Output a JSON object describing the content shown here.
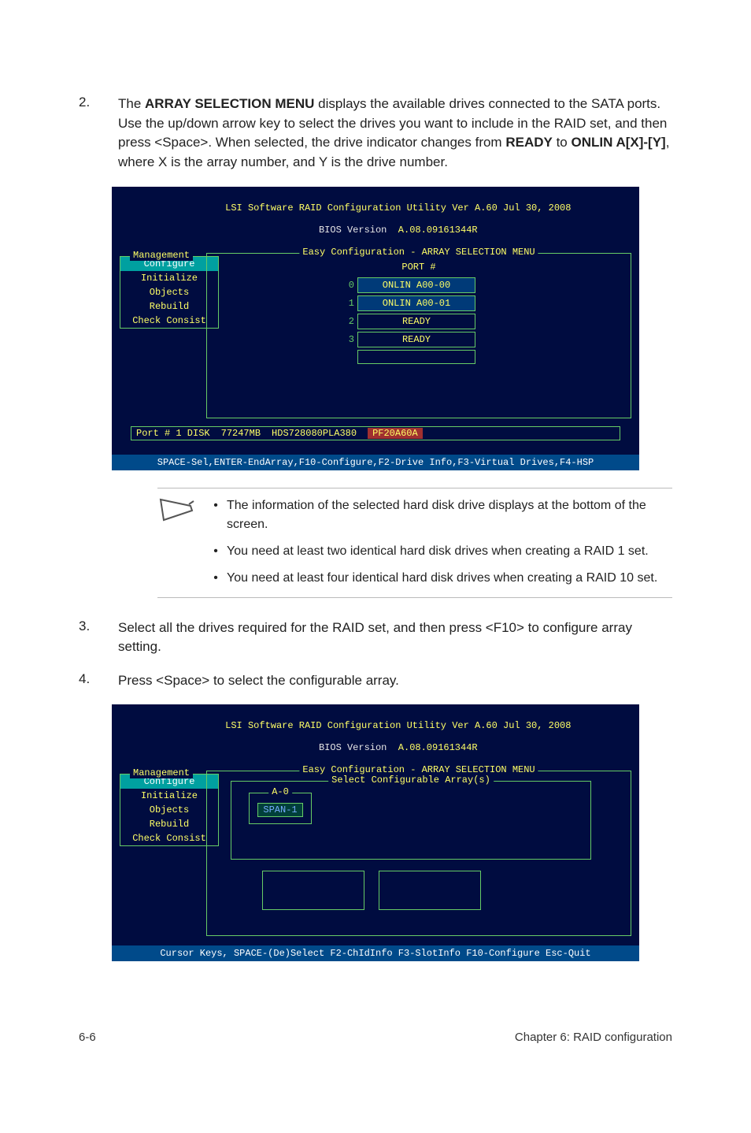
{
  "step2": {
    "num": "2.",
    "text_parts": {
      "p1": "The ",
      "b1": "ARRAY SELECTION MENU",
      "p2": " displays the available drives connected to the SATA ports. Use the up/down arrow key to select the drives you want to include in the RAID set, and then press <Space>. When selected, the drive indicator changes from ",
      "b2": "READY",
      "p3": " to ",
      "b3": "ONLIN A[X]-[Y]",
      "p4": ", where X is the array number, and Y is the drive number."
    }
  },
  "bios1": {
    "title_white": "LSI Software RAID Configuration Utility Ver A.60 Jul 30, 2008",
    "title_line2_a": "BIOS Version  ",
    "title_line2_b": "A.08.09161344R",
    "frame_title": "Easy Configuration - ARRAY SELECTION MENU",
    "sidebar_header": "Management",
    "sidebar": [
      "Configure",
      "Initialize",
      "Objects",
      "Rebuild",
      "Check Consist"
    ],
    "port_header": "PORT #",
    "drives": [
      {
        "n": "0",
        "label": "ONLIN A00-00",
        "cls": "onlin"
      },
      {
        "n": "1",
        "label": "ONLIN A00-01",
        "cls": "onlin"
      },
      {
        "n": "2",
        "label": "READY",
        "cls": "ready"
      },
      {
        "n": "3",
        "label": "READY",
        "cls": "ready"
      }
    ],
    "status": {
      "port": "Port # 1 DISK",
      "size": "77247MB",
      "model": "HDS728080PLA380",
      "pf": "PF20A60A"
    },
    "footer": "SPACE-Sel,ENTER-EndArray,F10-Configure,F2-Drive Info,F3-Virtual Drives,F4-HSP"
  },
  "notes": {
    "b1": "The information of the selected hard disk drive displays at the bottom of the screen.",
    "b2": "You need at least two identical hard disk drives when creating a RAID 1 set.",
    "b3": "You need at least four identical hard disk drives when creating a RAID 10 set."
  },
  "step3": {
    "num": "3.",
    "text": "Select all the drives required for the RAID set, and then press <F10> to configure array setting."
  },
  "step4": {
    "num": "4.",
    "text": "Press <Space> to select the configurable array."
  },
  "bios2": {
    "title_white": "LSI Software RAID Configuration Utility Ver A.60 Jul 30, 2008",
    "title_line2_a": "BIOS Version  ",
    "title_line2_b": "A.08.09161344R",
    "frame_title": "Easy Configuration - ARRAY SELECTION MENU",
    "inner_title": "Select Configurable Array(s)",
    "a0_title": "A-0",
    "span": "SPAN-1",
    "sidebar_header": "Management",
    "sidebar": [
      "Configure",
      "Initialize",
      "Objects",
      "Rebuild",
      "Check Consist"
    ],
    "footer": "Cursor Keys, SPACE-(De)Select F2-ChIdInfo F3-SlotInfo F10-Configure Esc-Quit"
  },
  "footer": {
    "left": "6-6",
    "right": "Chapter 6: RAID configuration"
  }
}
